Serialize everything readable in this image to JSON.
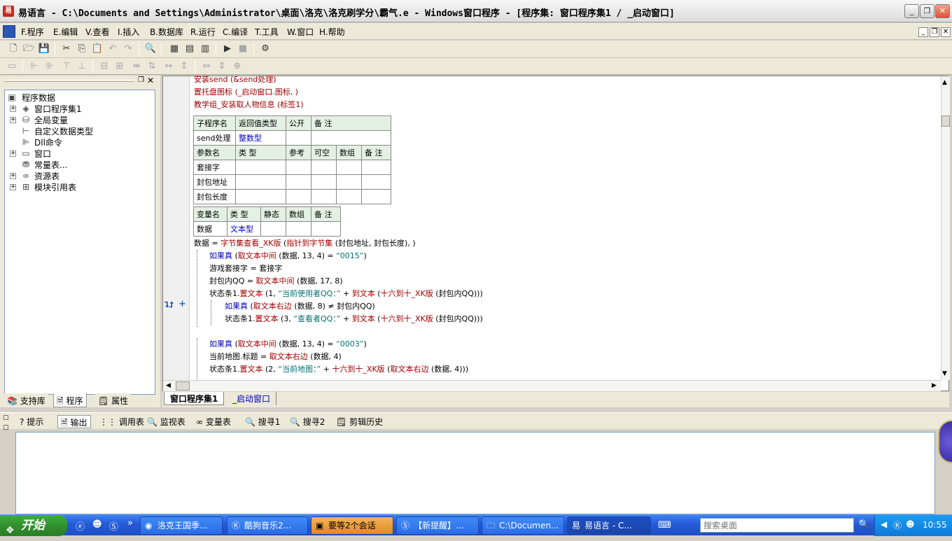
{
  "title": "易语言 - C:\\Documents and Settings\\Administrator\\桌面\\洛克\\洛克刷学分\\霸气.e - Windows窗口程序 - [程序集: 窗口程序集1 / _启动窗口]",
  "app_icon": "易",
  "window_buttons": [
    "_",
    "❐",
    "✕"
  ],
  "menu": [
    "F.程序",
    "E.编辑",
    "V.查看",
    "I.插入",
    "B.数据库",
    "R.运行",
    "C.编译",
    "T.工具",
    "W.窗口",
    "H.帮助"
  ],
  "tree": {
    "root": "程序数据",
    "items": [
      "窗口程序集1",
      "全局变量",
      "自定义数据类型",
      "Dll命令",
      "窗口",
      "常量表...",
      "资源表",
      "模块引用表"
    ]
  },
  "left_tabs": [
    "支持库",
    "程序",
    "属性"
  ],
  "code_top": {
    "line1": "安装send (&send处理)",
    "line2": "置托盘图标 (_启动窗口.图标, )",
    "line3": "教学组_安装取人物信息 (标签1)"
  },
  "sub_table": {
    "h1": [
      "子程序名",
      "返回值类型",
      "公开",
      "备 注"
    ],
    "r1": [
      "send处理",
      "整数型",
      "",
      ""
    ],
    "h2": [
      "参数名",
      "类 型",
      "参考",
      "可空",
      "数组",
      "备 注"
    ],
    "params": [
      "套接字",
      "封包地址",
      "封包长度"
    ]
  },
  "var_table": {
    "h": [
      "变量名",
      "类 型",
      "静态",
      "数组",
      "备 注"
    ],
    "r": [
      "数据",
      "文本型",
      "",
      "",
      ""
    ]
  },
  "code": {
    "c1a": "数据 = ",
    "c1b": "字节集查看_XK版",
    "c1c": " (",
    "c1d": "指针到字节集",
    "c1e": " (封包地址, 封包长度), )",
    "c2a": "如果真",
    "c2b": " (",
    "c2c": "取文本中间",
    "c2d": " (数据, 13, 4) = ",
    "c2e": "“0015”",
    "c2f": ")",
    "c3": "游戏套接字 = 套接字",
    "c4a": "封包内QQ = ",
    "c4b": "取文本中间",
    "c4c": " (数据, 17, 8)",
    "c5a": "状态条1.",
    "c5b": "置文本",
    "c5c": " (1, ",
    "c5d": "“当前使用者QQ：”",
    "c5e": " + ",
    "c5f": "到文本",
    "c5g": " (",
    "c5h": "十六到十_XK版",
    "c5i": " (封包内QQ)))",
    "c6a": "如果真",
    "c6b": " (",
    "c6c": "取文本右边",
    "c6d": " (数据, 8) ≠ 封包内QQ)",
    "c7a": "状态条1.",
    "c7b": "置文本",
    "c7c": " (3, ",
    "c7d": "“查看者QQ：”",
    "c7e": " + ",
    "c7f": "到文本",
    "c7g": " (",
    "c7h": "十六到十_XK版",
    "c7i": " (封包内QQ)))",
    "c8a": "如果真",
    "c8b": " (",
    "c8c": "取文本中间",
    "c8d": " (数据, 13, 4) = ",
    "c8e": "“0003”",
    "c8f": ")",
    "c9a": "当前地图.标题 = ",
    "c9b": "取文本右边",
    "c9c": " (数据, 4)",
    "c10a": "状态条1.",
    "c10b": "置文本",
    "c10c": " (2, ",
    "c10d": "“当前地图：”",
    "c10e": " + ",
    "c10f": "十六到十_XK版",
    "c10g": " (",
    "c10h": "取文本右边",
    "c10i": " (数据, 4)))"
  },
  "editor_tabs": [
    "窗口程序集1",
    "_启动窗口"
  ],
  "bottom_tabs": [
    "提示",
    "输出",
    "调用表",
    "监视表",
    "变量表",
    "搜寻1",
    "搜寻2",
    "剪辑历史"
  ],
  "taskbar": {
    "start": "开始",
    "tasks": [
      "洛克王国季...",
      "酷狗音乐2...",
      "要等2个会话",
      "【新提醒】...",
      "C:\\Documen...",
      "易语言 - C..."
    ],
    "search_placeholder": "搜索桌面",
    "clock": "10:55"
  },
  "colors": {
    "code_red": "#a00000",
    "code_blue": "#0000c0",
    "code_teal": "#007070",
    "taskbar_blue": "#2459d6"
  }
}
